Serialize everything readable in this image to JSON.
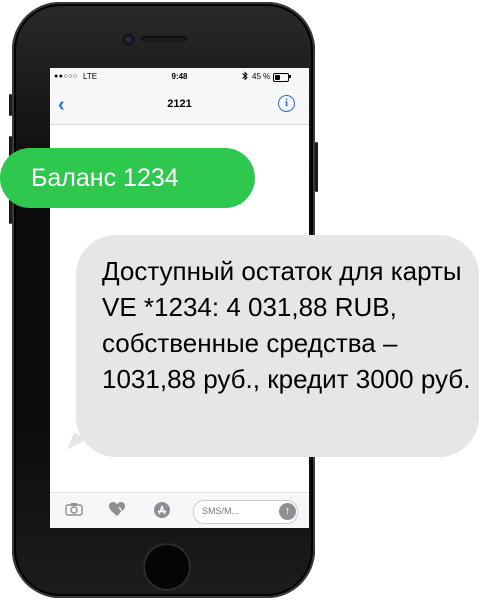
{
  "status_bar": {
    "signal": "●●○○○",
    "carrier": "LTE",
    "time": "9:48",
    "bluetooth_icon": "bluetooth-icon",
    "battery_percent": "45 %",
    "battery_level": 0.45
  },
  "nav": {
    "back_icon": "chevron-left-icon",
    "back_glyph": "‹",
    "title": "2121",
    "info_glyph": "i"
  },
  "messages": {
    "sent": "Баланс 1234",
    "received": "Доступный остаток для карты VE *1234: 4 031,88 RUB, собственные средства – 1031,88 руб., кредит 3000 руб."
  },
  "input_bar": {
    "camera_icon": "camera-icon",
    "digital_touch_icon": "heart-hand-icon",
    "app_store_icon": "app-store-icon",
    "placeholder": "SMS/M...",
    "send_glyph": "↑"
  },
  "colors": {
    "sent_bubble": "#2ec84f",
    "received_bubble": "#e6e6e8",
    "ios_blue": "#1a73e8"
  }
}
